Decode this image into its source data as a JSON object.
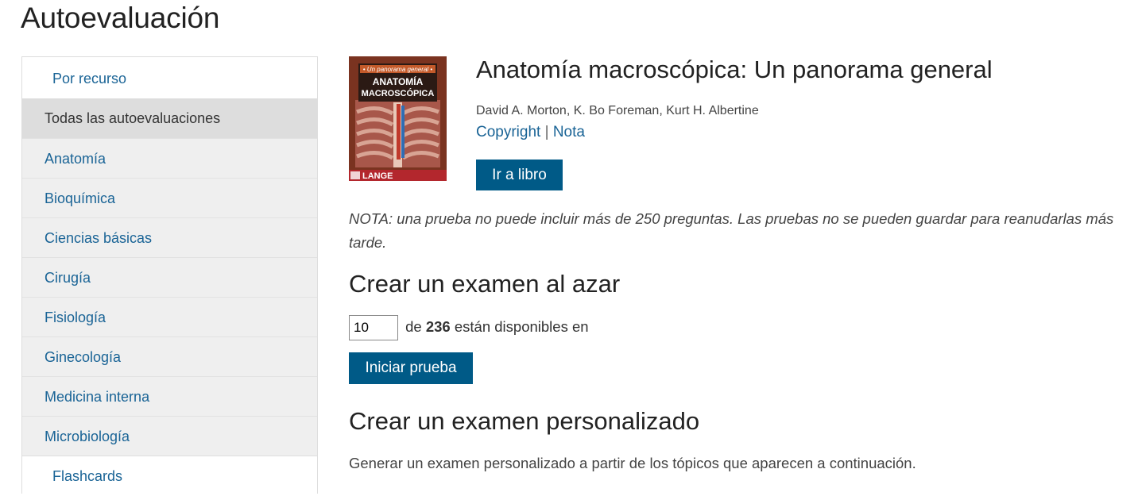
{
  "page": {
    "title": "Autoevaluación"
  },
  "sidebar": {
    "header": "Por recurso",
    "active": "Todas las autoevaluaciones",
    "items": [
      {
        "label": "Anatomía"
      },
      {
        "label": "Bioquímica"
      },
      {
        "label": "Ciencias básicas"
      },
      {
        "label": "Cirugía"
      },
      {
        "label": "Fisiología"
      },
      {
        "label": "Ginecología"
      },
      {
        "label": "Medicina interna"
      },
      {
        "label": "Microbiología"
      }
    ],
    "footer": "Flashcards"
  },
  "book": {
    "cover": {
      "line1": "• Un panorama general •",
      "line2": "ANATOMÍA",
      "line3": "MACROSCÓPICA",
      "publisher": "LANGE"
    },
    "title": "Anatomía macroscópica: Un panorama general",
    "authors": "David A. Morton, K. Bo Foreman, Kurt H. Albertine",
    "copyright_link": "Copyright",
    "separator": "|",
    "note_link": "Nota",
    "go_button": "Ir a libro"
  },
  "note_text": "NOTA: una prueba no puede incluir más de 250 preguntas. Las pruebas no se pueden guardar para reanudarlas más tarde.",
  "random_exam": {
    "heading": "Crear un examen al azar",
    "input_value": "10",
    "of_text": "de",
    "available_count": "236",
    "available_text": "están disponibles en",
    "start_button": "Iniciar prueba"
  },
  "custom_exam": {
    "heading": "Crear un examen personalizado",
    "description": "Generar un examen personalizado a partir de los tópicos que aparecen a continuación."
  },
  "colors": {
    "link": "#1a6496",
    "button": "#005a87",
    "sidebar_active": "#dddddd",
    "sidebar_item": "#efefef"
  }
}
